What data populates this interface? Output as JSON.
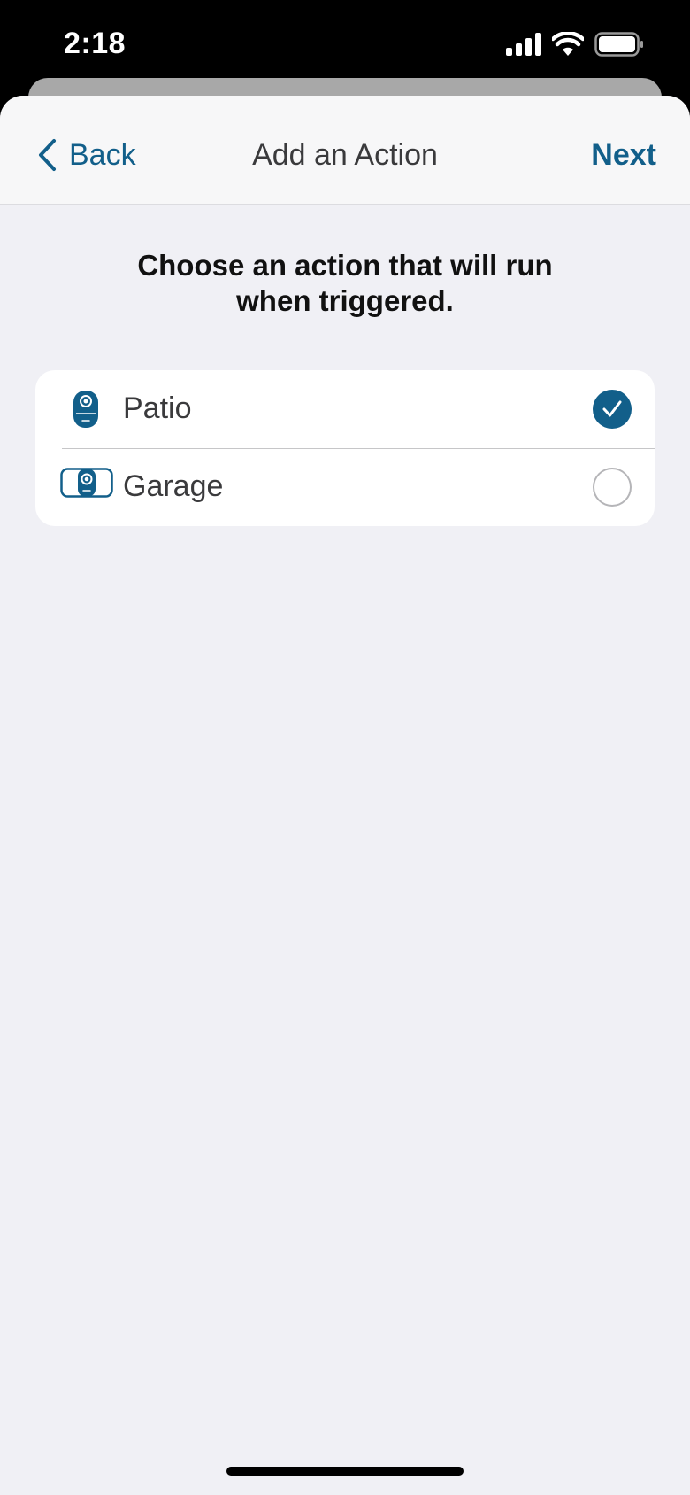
{
  "status_bar": {
    "time": "2:18"
  },
  "nav": {
    "back_label": "Back",
    "title": "Add an Action",
    "next_label": "Next"
  },
  "instruction": "Choose an action that will run when triggered.",
  "devices": [
    {
      "name": "Patio",
      "icon": "camera-indoor-icon",
      "selected": true
    },
    {
      "name": "Garage",
      "icon": "camera-outdoor-icon",
      "selected": false
    }
  ],
  "colors": {
    "accent": "#125f8a",
    "background": "#f0f0f5",
    "card": "#ffffff"
  }
}
